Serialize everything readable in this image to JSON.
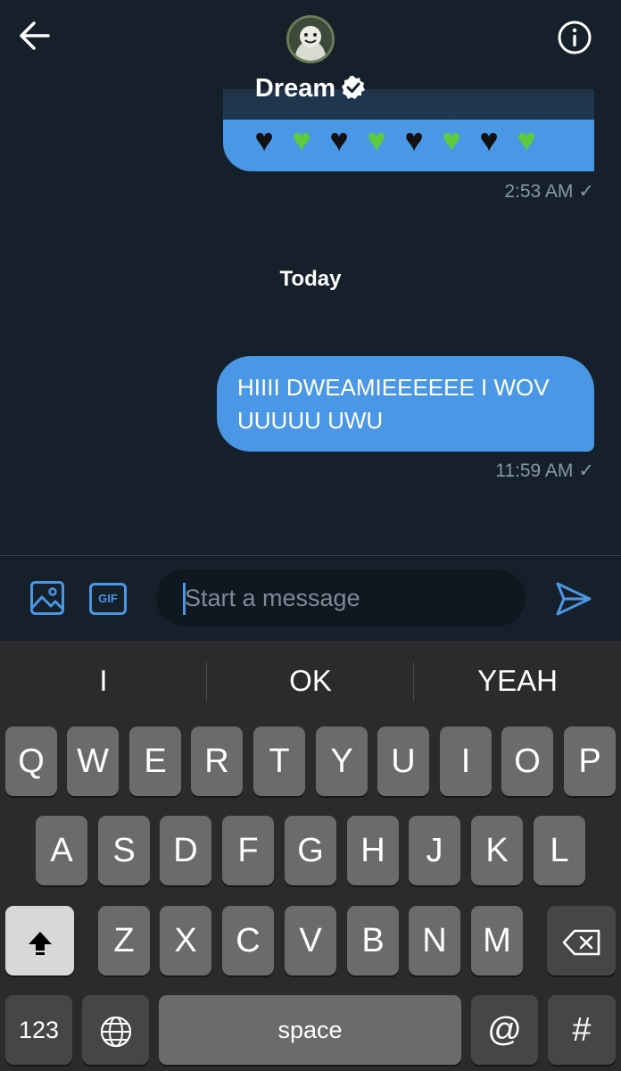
{
  "header": {
    "username": "Dream",
    "icons": {
      "back": "back-arrow-icon",
      "info": "info-icon",
      "verified": "verified-badge-icon",
      "avatar": "avatar"
    }
  },
  "messages": [
    {
      "text": "🖤💚🖤💚🖤💚🖤💚",
      "time": "2:53 AM"
    },
    {
      "text": "HIIII DWEAMIEEEEEE I WOV UUUUU UWU",
      "time": "11:59 AM"
    }
  ],
  "day_separator": "Today",
  "composer": {
    "placeholder": "Start a message",
    "gif_label": "GIF",
    "icons": {
      "media": "image-icon",
      "send": "send-icon"
    }
  },
  "keyboard": {
    "suggestions": [
      "I",
      "OK",
      "YEAH"
    ],
    "row1": [
      "Q",
      "W",
      "E",
      "R",
      "T",
      "Y",
      "U",
      "I",
      "O",
      "P"
    ],
    "row2": [
      "A",
      "S",
      "D",
      "F",
      "G",
      "H",
      "J",
      "K",
      "L"
    ],
    "row3": [
      "Z",
      "X",
      "C",
      "V",
      "B",
      "N",
      "M"
    ],
    "numbers_label": "123",
    "space_label": "space",
    "at_label": "@",
    "hash_label": "#",
    "icons": {
      "shift": "shift-icon",
      "backspace": "backspace-icon",
      "globe": "globe-icon"
    }
  },
  "colors": {
    "background": "#15202b",
    "bubble": "#4a97e5",
    "accent": "#4a97e5",
    "keyboard": "#2b2b2d"
  }
}
